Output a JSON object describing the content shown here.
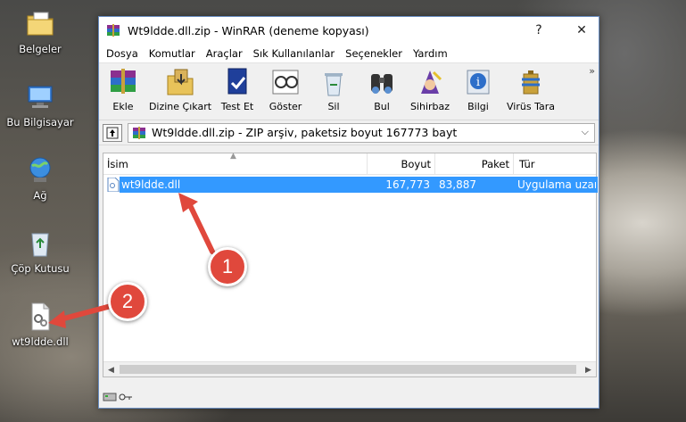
{
  "desktop": {
    "icons": [
      {
        "label": "Belgeler"
      },
      {
        "label": "Bu Bilgisayar"
      },
      {
        "label": "Ağ"
      },
      {
        "label": "Çöp Kutusu"
      },
      {
        "label": "wt9ldde.dll"
      }
    ]
  },
  "window": {
    "title": "Wt9ldde.dll.zip - WinRAR (deneme kopyası)",
    "help_label": "?",
    "close_label": "✕"
  },
  "menu": [
    "Dosya",
    "Komutlar",
    "Araçlar",
    "Sık Kullanılanlar",
    "Seçenekler",
    "Yardım"
  ],
  "toolbar": {
    "buttons": [
      {
        "label": "Ekle",
        "icon": "add-archive-icon"
      },
      {
        "label": "Dizine Çıkart",
        "icon": "extract-to-icon"
      },
      {
        "label": "Test Et",
        "icon": "test-icon"
      },
      {
        "label": "Göster",
        "icon": "view-icon"
      },
      {
        "label": "Sil",
        "icon": "delete-icon"
      },
      {
        "label": "Bul",
        "icon": "find-icon"
      },
      {
        "label": "Sihirbaz",
        "icon": "wizard-icon"
      },
      {
        "label": "Bilgi",
        "icon": "info-icon"
      },
      {
        "label": "Virüs Tara",
        "icon": "virus-scan-icon"
      }
    ],
    "more_label": "»"
  },
  "address": {
    "path": "Wt9ldde.dll.zip - ZIP arşiv, paketsiz boyut 167773 bayt",
    "dropdown_glyph": "⌵"
  },
  "columns": [
    "İsim",
    "Boyut",
    "Paket",
    "Tür"
  ],
  "files": [
    {
      "name": "wt9ldde.dll",
      "size": "167,773",
      "packed": "83,887",
      "type": "Uygulama uzan"
    }
  ],
  "annotations": {
    "first": "1",
    "second": "2"
  },
  "colors": {
    "selection": "#3399ff",
    "badge": "#e0483c",
    "window_border": "#6a8fc4"
  }
}
